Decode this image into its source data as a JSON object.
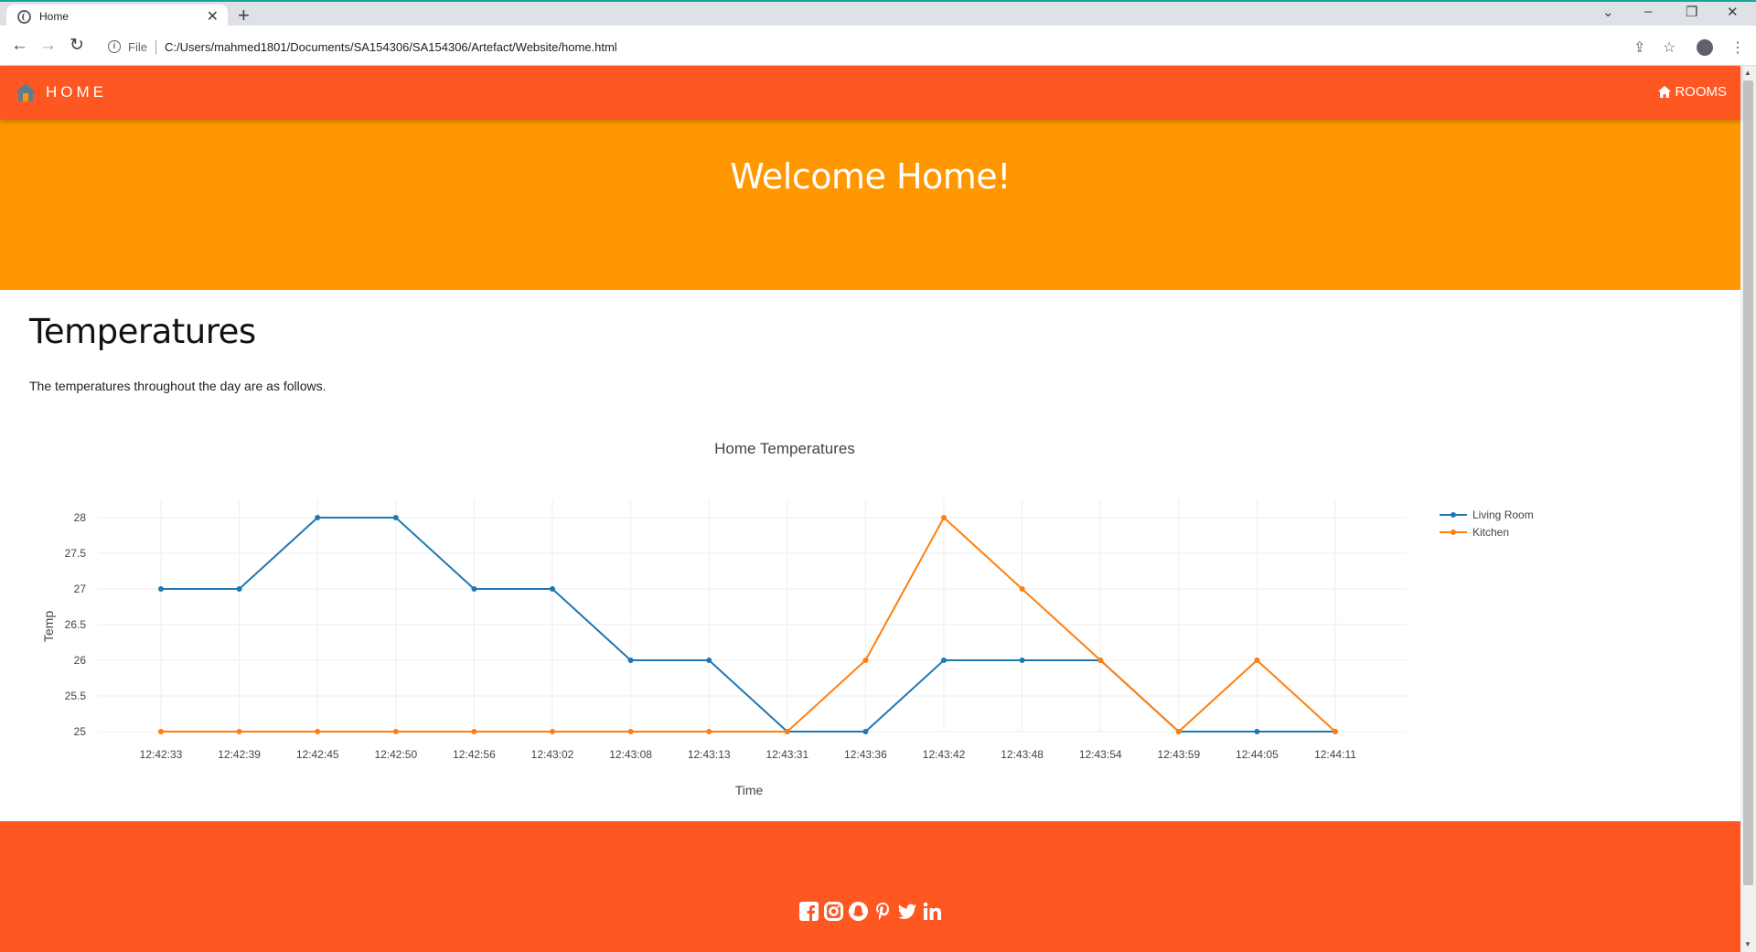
{
  "browser": {
    "tab_title": "Home",
    "address_prefix": "File",
    "address": "C:/Users/mahmed1801/Documents/SA154306/SA154306/Artefact/Website/home.html"
  },
  "navbar": {
    "brand": "HOME",
    "rooms_label": "ROOMS"
  },
  "hero": {
    "title": "Welcome Home!"
  },
  "section": {
    "heading": "Temperatures",
    "description": "The temperatures throughout the day are as follows."
  },
  "chart_data": {
    "type": "line",
    "title": "Home Temperatures",
    "xlabel": "Time",
    "ylabel": "Temp",
    "categories": [
      "12:42:33",
      "12:42:39",
      "12:42:45",
      "12:42:50",
      "12:42:56",
      "12:43:02",
      "12:43:08",
      "12:43:13",
      "12:43:31",
      "12:43:36",
      "12:43:42",
      "12:43:48",
      "12:43:54",
      "12:43:59",
      "12:44:05",
      "12:44:11"
    ],
    "yticks": [
      "25",
      "25.5",
      "26",
      "26.5",
      "27",
      "27.5",
      "28"
    ],
    "ylim": [
      25,
      28
    ],
    "grid": true,
    "legend_position": "top-right",
    "series": [
      {
        "name": "Living Room",
        "color": "#1f77b4",
        "values": [
          27,
          27,
          28,
          28,
          27,
          27,
          26,
          26,
          25,
          25,
          26,
          26,
          26,
          25,
          25,
          25
        ]
      },
      {
        "name": "Kitchen",
        "color": "#ff7f0e",
        "values": [
          25,
          25,
          25,
          25,
          25,
          25,
          25,
          25,
          25,
          26,
          28,
          27,
          26,
          25,
          26,
          25
        ]
      }
    ]
  },
  "footer": {
    "social_icons": [
      "facebook-icon",
      "instagram-icon",
      "snapchat-icon",
      "pinterest-icon",
      "twitter-icon",
      "linkedin-icon"
    ]
  },
  "colors": {
    "navbar": "#ff5722",
    "hero": "#ff9800",
    "footer": "#ff5722"
  }
}
